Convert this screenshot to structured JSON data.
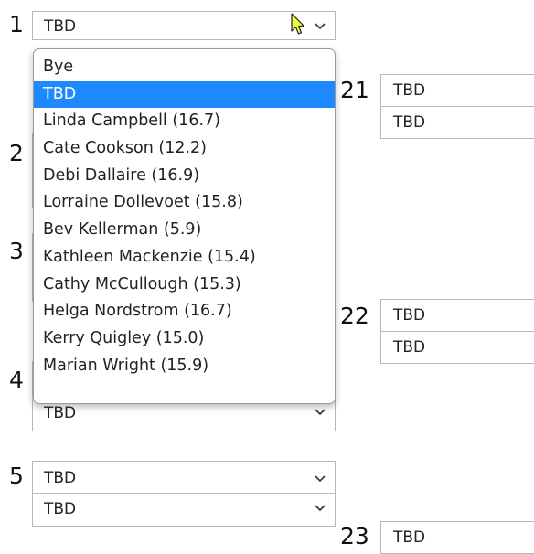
{
  "rounds": {
    "left_numbers": [
      "1",
      "2",
      "3",
      "4",
      "5"
    ],
    "right_numbers": [
      "21",
      "22",
      "23"
    ]
  },
  "selects": {
    "match1_top": "TBD",
    "match4_bottom": "TBD",
    "match5_top": "TBD",
    "match5_bottom": "TBD"
  },
  "right_matches": {
    "m21_top": "TBD",
    "m21_bottom": "TBD",
    "m22_top": "TBD",
    "m22_bottom": "TBD",
    "m23_top": "TBD"
  },
  "dropdown": {
    "options": [
      "Bye",
      "TBD",
      "Linda Campbell (16.7)",
      "Cate Cookson (12.2)",
      "Debi Dallaire (16.9)",
      "Lorraine Dollevoet (15.8)",
      "Bev Kellerman (5.9)",
      "Kathleen Mackenzie (15.4)",
      "Cathy McCullough (15.3)",
      "Helga Nordstrom (16.7)",
      "Kerry Quigley (15.0)",
      "Marian Wright (15.9)"
    ],
    "selected": "TBD"
  },
  "icons": {
    "chevron": "chevron-down-icon",
    "cursor": "mouse-pointer-icon"
  },
  "colors": {
    "highlight": "#1e88ff",
    "border": "#b8b8b8"
  }
}
